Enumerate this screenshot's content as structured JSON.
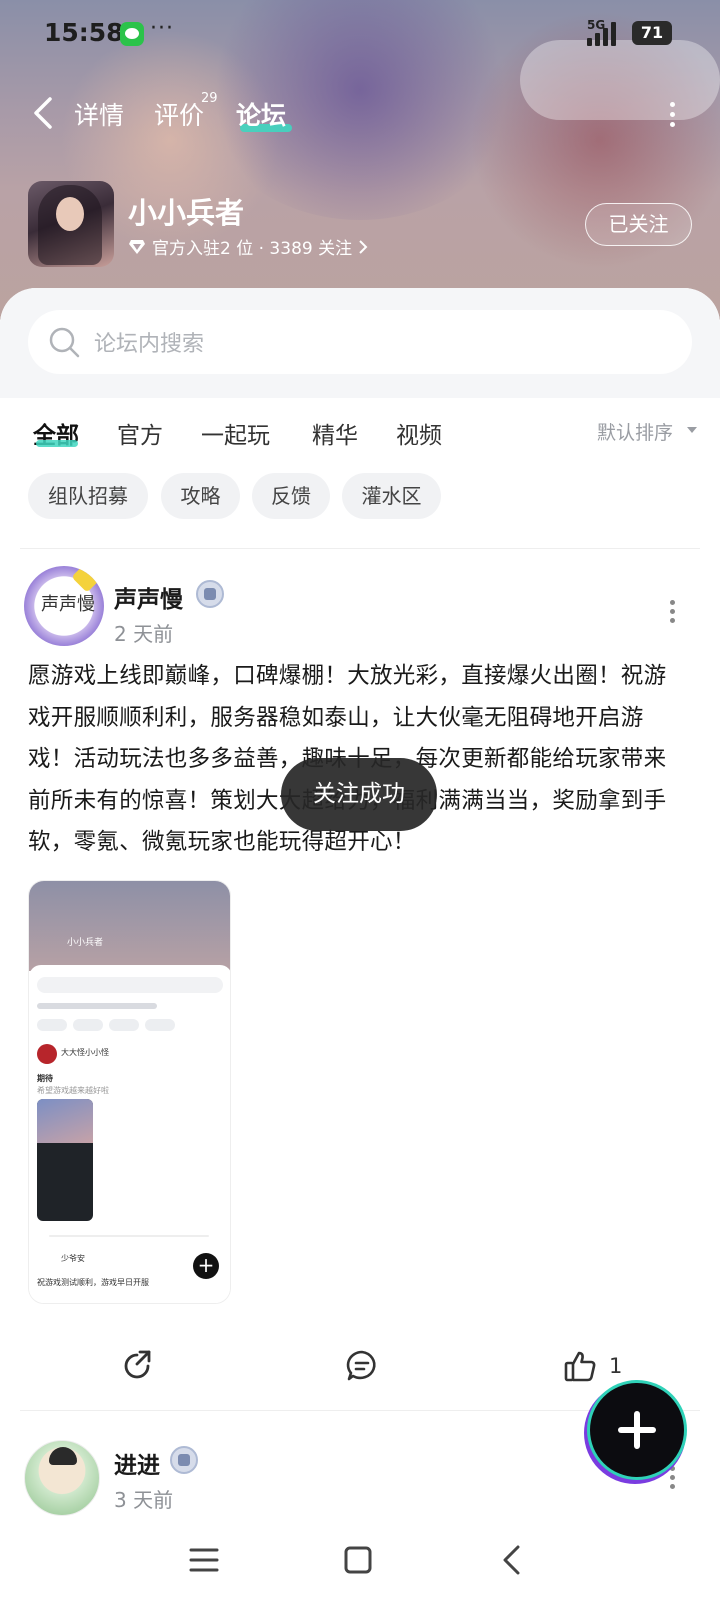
{
  "status_bar": {
    "time": "15:58",
    "dots": "···",
    "network": "5G",
    "battery": "71"
  },
  "nav": {
    "tabs": [
      {
        "label": "详情"
      },
      {
        "label": "评价",
        "count": "29"
      },
      {
        "label": "论坛"
      }
    ],
    "active_tab": "论坛"
  },
  "game": {
    "title": "小小兵者",
    "meta": "官方入驻2 位 · 3389 关注",
    "follow_label": "已关注"
  },
  "search": {
    "placeholder": "论坛内搜索"
  },
  "filters": {
    "tabs": [
      "全部",
      "官方",
      "一起玩",
      "精华",
      "视频"
    ],
    "active": "全部",
    "sort_label": "默认排序"
  },
  "chips": [
    "组队招募",
    "攻略",
    "反馈",
    "灌水区"
  ],
  "posts": [
    {
      "username": "声声慢",
      "avatar_text": "声声慢",
      "time": "2 天前",
      "body": "愿游戏上线即巅峰，口碑爆棚！大放光彩，直接爆火出圈！祝游戏开服顺顺利利，服务器稳如泰山，让大伙毫无阻碍地开启游戏！活动玩法也多多益善，趣味十足，每次更新都能给玩家带来前所未有的惊喜！策划大大超给力，福利满满当当，奖励拿到手软，零氪、微氪玩家也能玩得超开心！",
      "thumb": {
        "title": "小小兵者",
        "post_user": "大大怪小小怪",
        "post_title": "期待",
        "post_sub": "希望游戏越来越好啦",
        "next_user": "少爷安",
        "next_text": "祝游戏测试顺利，游戏早日开服"
      },
      "like_count": "1"
    },
    {
      "username": "进进",
      "time": "3 天前"
    }
  ],
  "toast": "关注成功",
  "colors": {
    "accent": "#3fd6c0",
    "chip_bg": "#f1f2f4",
    "toast_bg": "#262626"
  },
  "icons": {
    "back": "chevron-left-icon",
    "more": "more-vertical-icon",
    "search": "search-icon",
    "share": "share-icon",
    "comment": "comment-icon",
    "like": "thumbs-up-icon",
    "fab": "plus-icon"
  }
}
